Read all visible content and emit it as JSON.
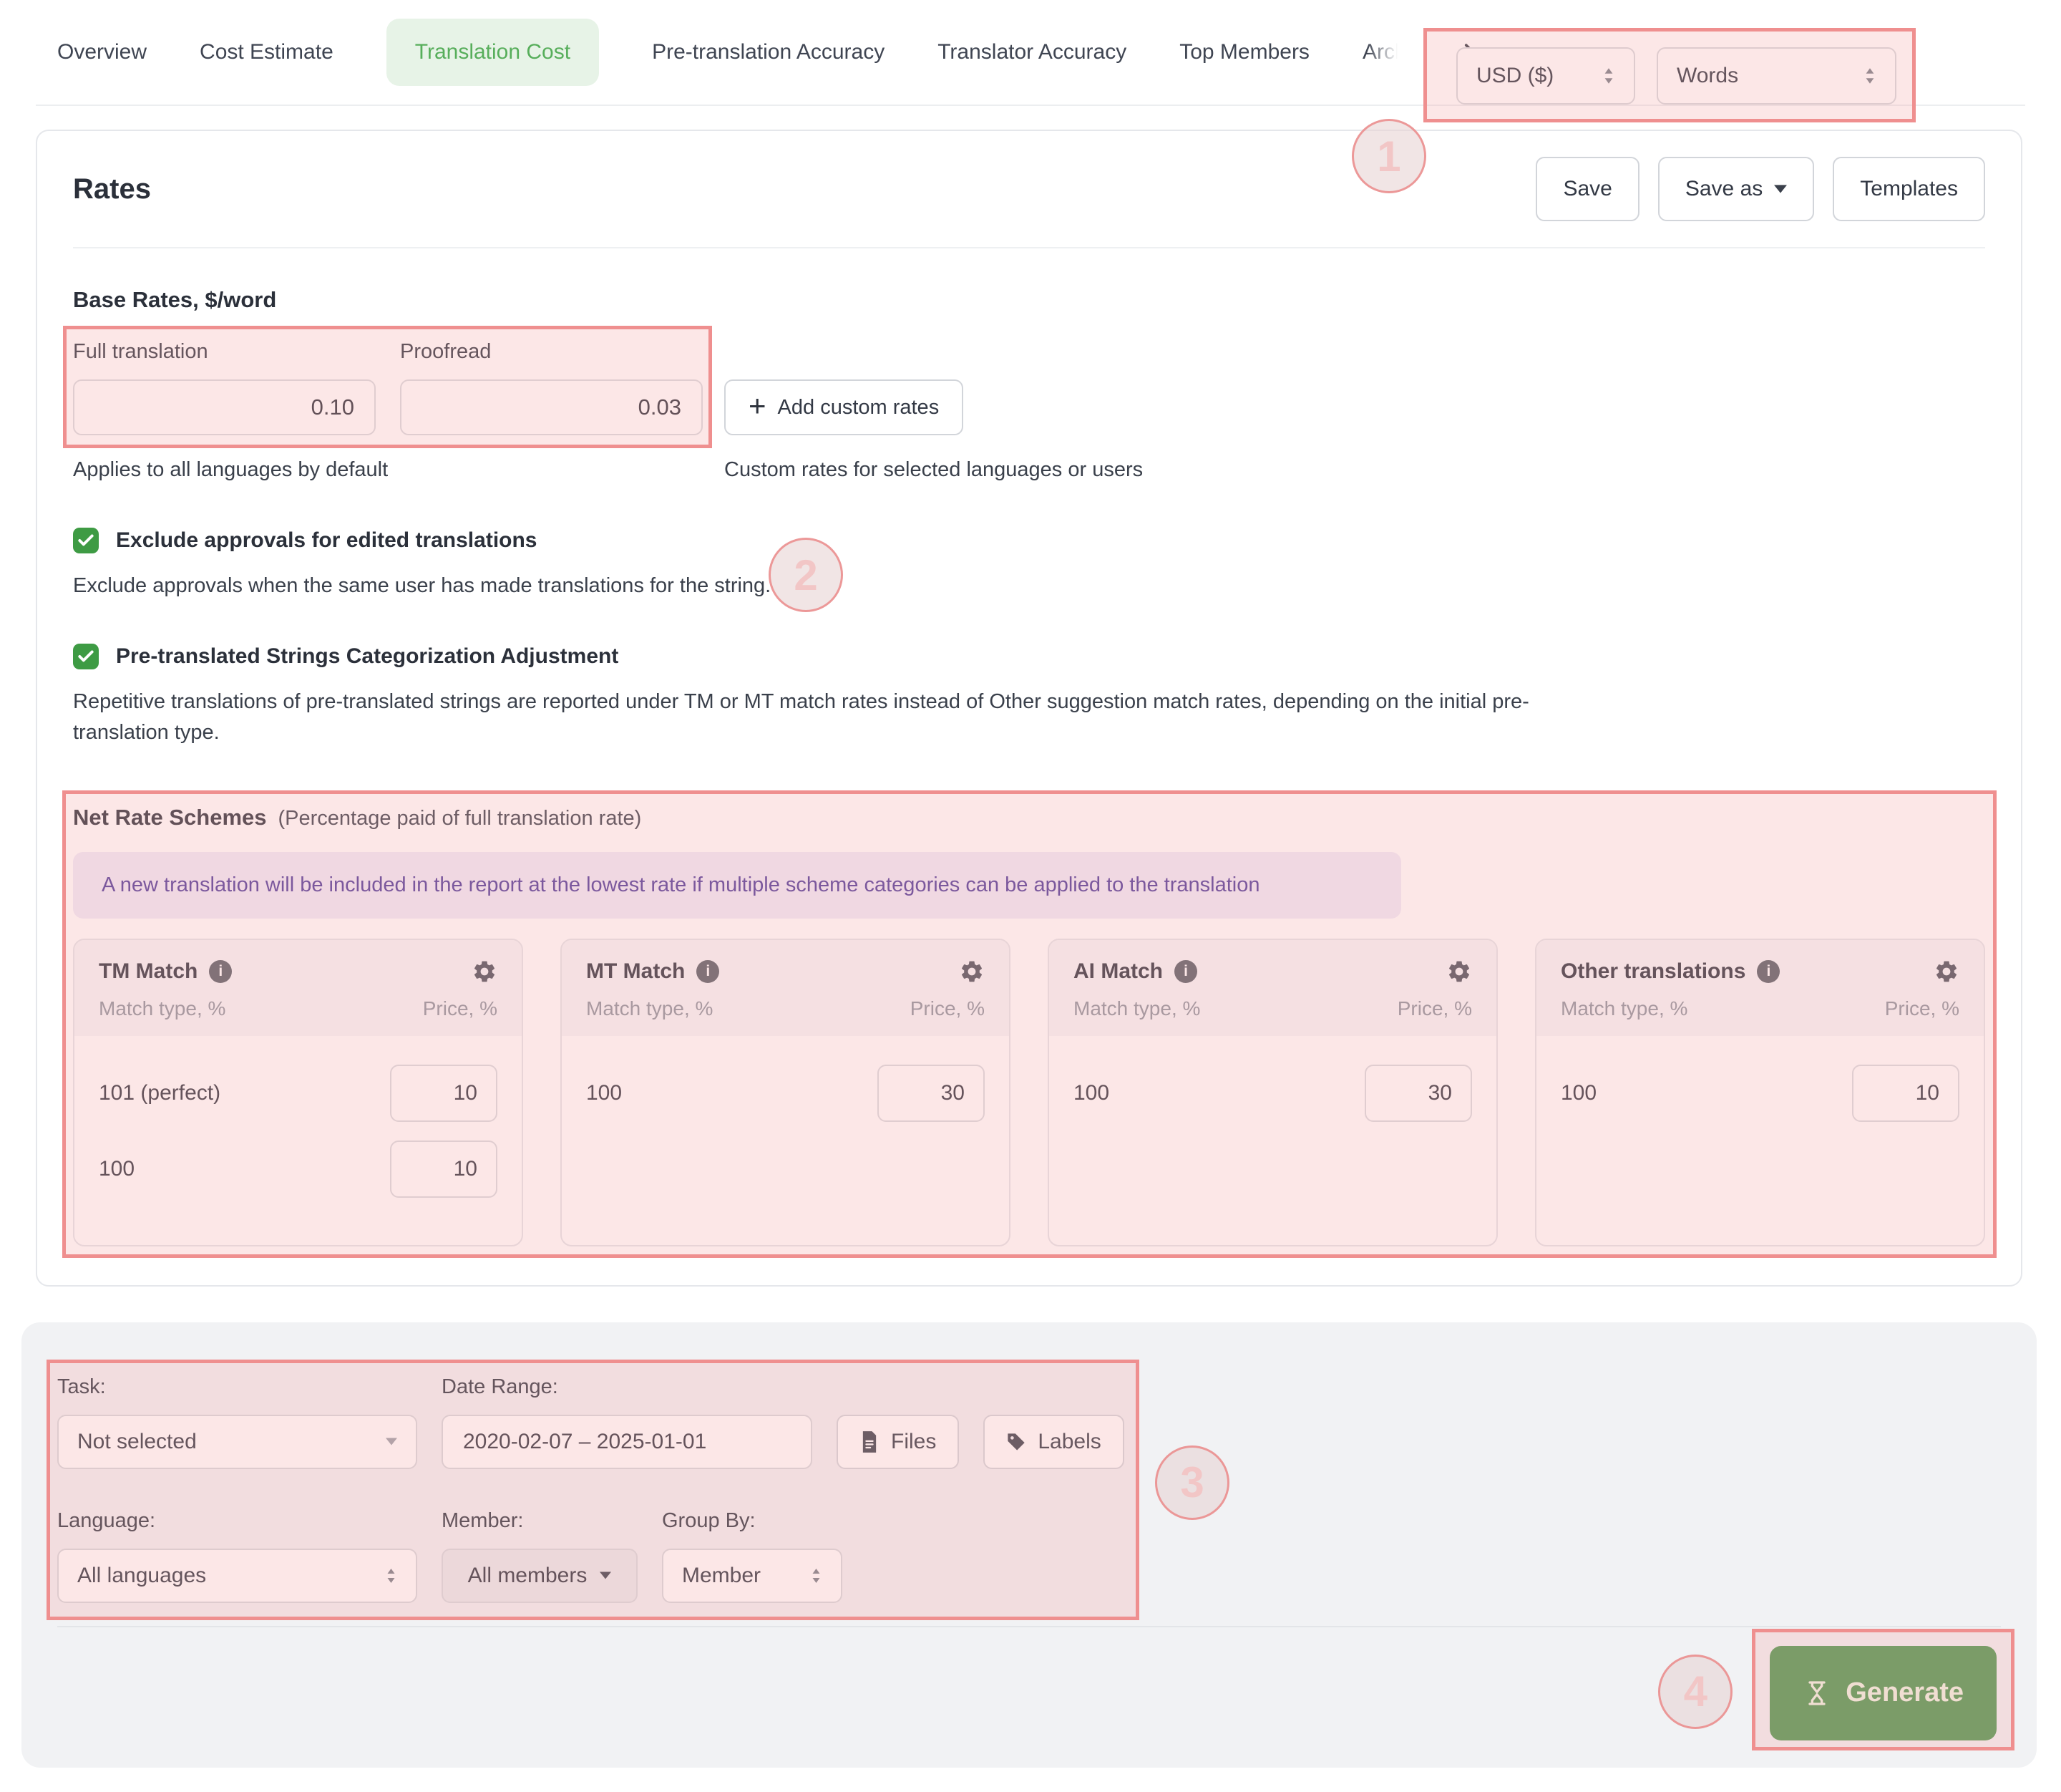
{
  "header": {
    "tabs": [
      {
        "label": "Overview"
      },
      {
        "label": "Cost Estimate"
      },
      {
        "label": "Translation Cost",
        "active": true
      },
      {
        "label": "Pre-translation Accuracy"
      },
      {
        "label": "Translator Accuracy"
      },
      {
        "label": "Top Members"
      },
      {
        "label": "Archive",
        "truncated": true
      }
    ],
    "currency_select": {
      "value": "USD ($)"
    },
    "unit_select": {
      "value": "Words"
    }
  },
  "rates": {
    "title": "Rates",
    "actions": {
      "save": "Save",
      "save_as": "Save as",
      "templates": "Templates"
    },
    "base": {
      "heading": "Base Rates, $/word",
      "fields": [
        {
          "label": "Full translation",
          "value": "0.10"
        },
        {
          "label": "Proofread",
          "value": "0.03"
        }
      ],
      "add_button": "Add custom rates",
      "caption_left": "Applies to all languages by default",
      "caption_right": "Custom rates for selected languages or users"
    },
    "toggles": [
      {
        "label": "Exclude approvals for edited translations",
        "checked": true,
        "description": "Exclude approvals when the same user has made translations for the string."
      },
      {
        "label": "Pre-translated Strings Categorization Adjustment",
        "checked": true,
        "description": "Repetitive translations of pre-translated strings are reported under TM or MT match rates instead of Other suggestion match rates, depending on the initial pre-translation type."
      }
    ],
    "net": {
      "heading": "Net Rate Schemes",
      "subheading": "(Percentage paid of full translation rate)",
      "notice": "A new translation will be included in the report at the lowest rate if multiple scheme categories can be applied to the translation",
      "match_type_header": "Match type, %",
      "price_header": "Price, %",
      "columns": [
        {
          "title": "TM Match",
          "rows": [
            {
              "match": "101 (perfect)",
              "price": "10"
            },
            {
              "match": "100",
              "price": "10"
            }
          ]
        },
        {
          "title": "MT Match",
          "rows": [
            {
              "match": "100",
              "price": "30"
            }
          ]
        },
        {
          "title": "AI Match",
          "rows": [
            {
              "match": "100",
              "price": "30"
            }
          ]
        },
        {
          "title": "Other translations",
          "rows": [
            {
              "match": "100",
              "price": "10"
            }
          ]
        }
      ]
    }
  },
  "filters": {
    "task": {
      "label": "Task:",
      "value": "Not selected"
    },
    "date_range": {
      "label": "Date Range:",
      "value": "2020-02-07 – 2025-01-01"
    },
    "files_button": "Files",
    "labels_button": "Labels",
    "language": {
      "label": "Language:",
      "value": "All languages"
    },
    "member": {
      "label": "Member:",
      "value": "All members"
    },
    "group_by": {
      "label": "Group By:",
      "value": "Member"
    },
    "generate_button": "Generate"
  },
  "annotations": {
    "step1": "1",
    "step2": "2",
    "step3": "3",
    "step4": "4"
  },
  "colors": {
    "accent_green": "#57ae5b",
    "tab_pill_bg": "#e7f3e7",
    "checkbox_green": "#3e9b44",
    "generate_green": "#4d9750",
    "annotation_red": "#ef8f8f",
    "notice_text": "#4d3a99",
    "notice_bg": "#efebf8"
  }
}
